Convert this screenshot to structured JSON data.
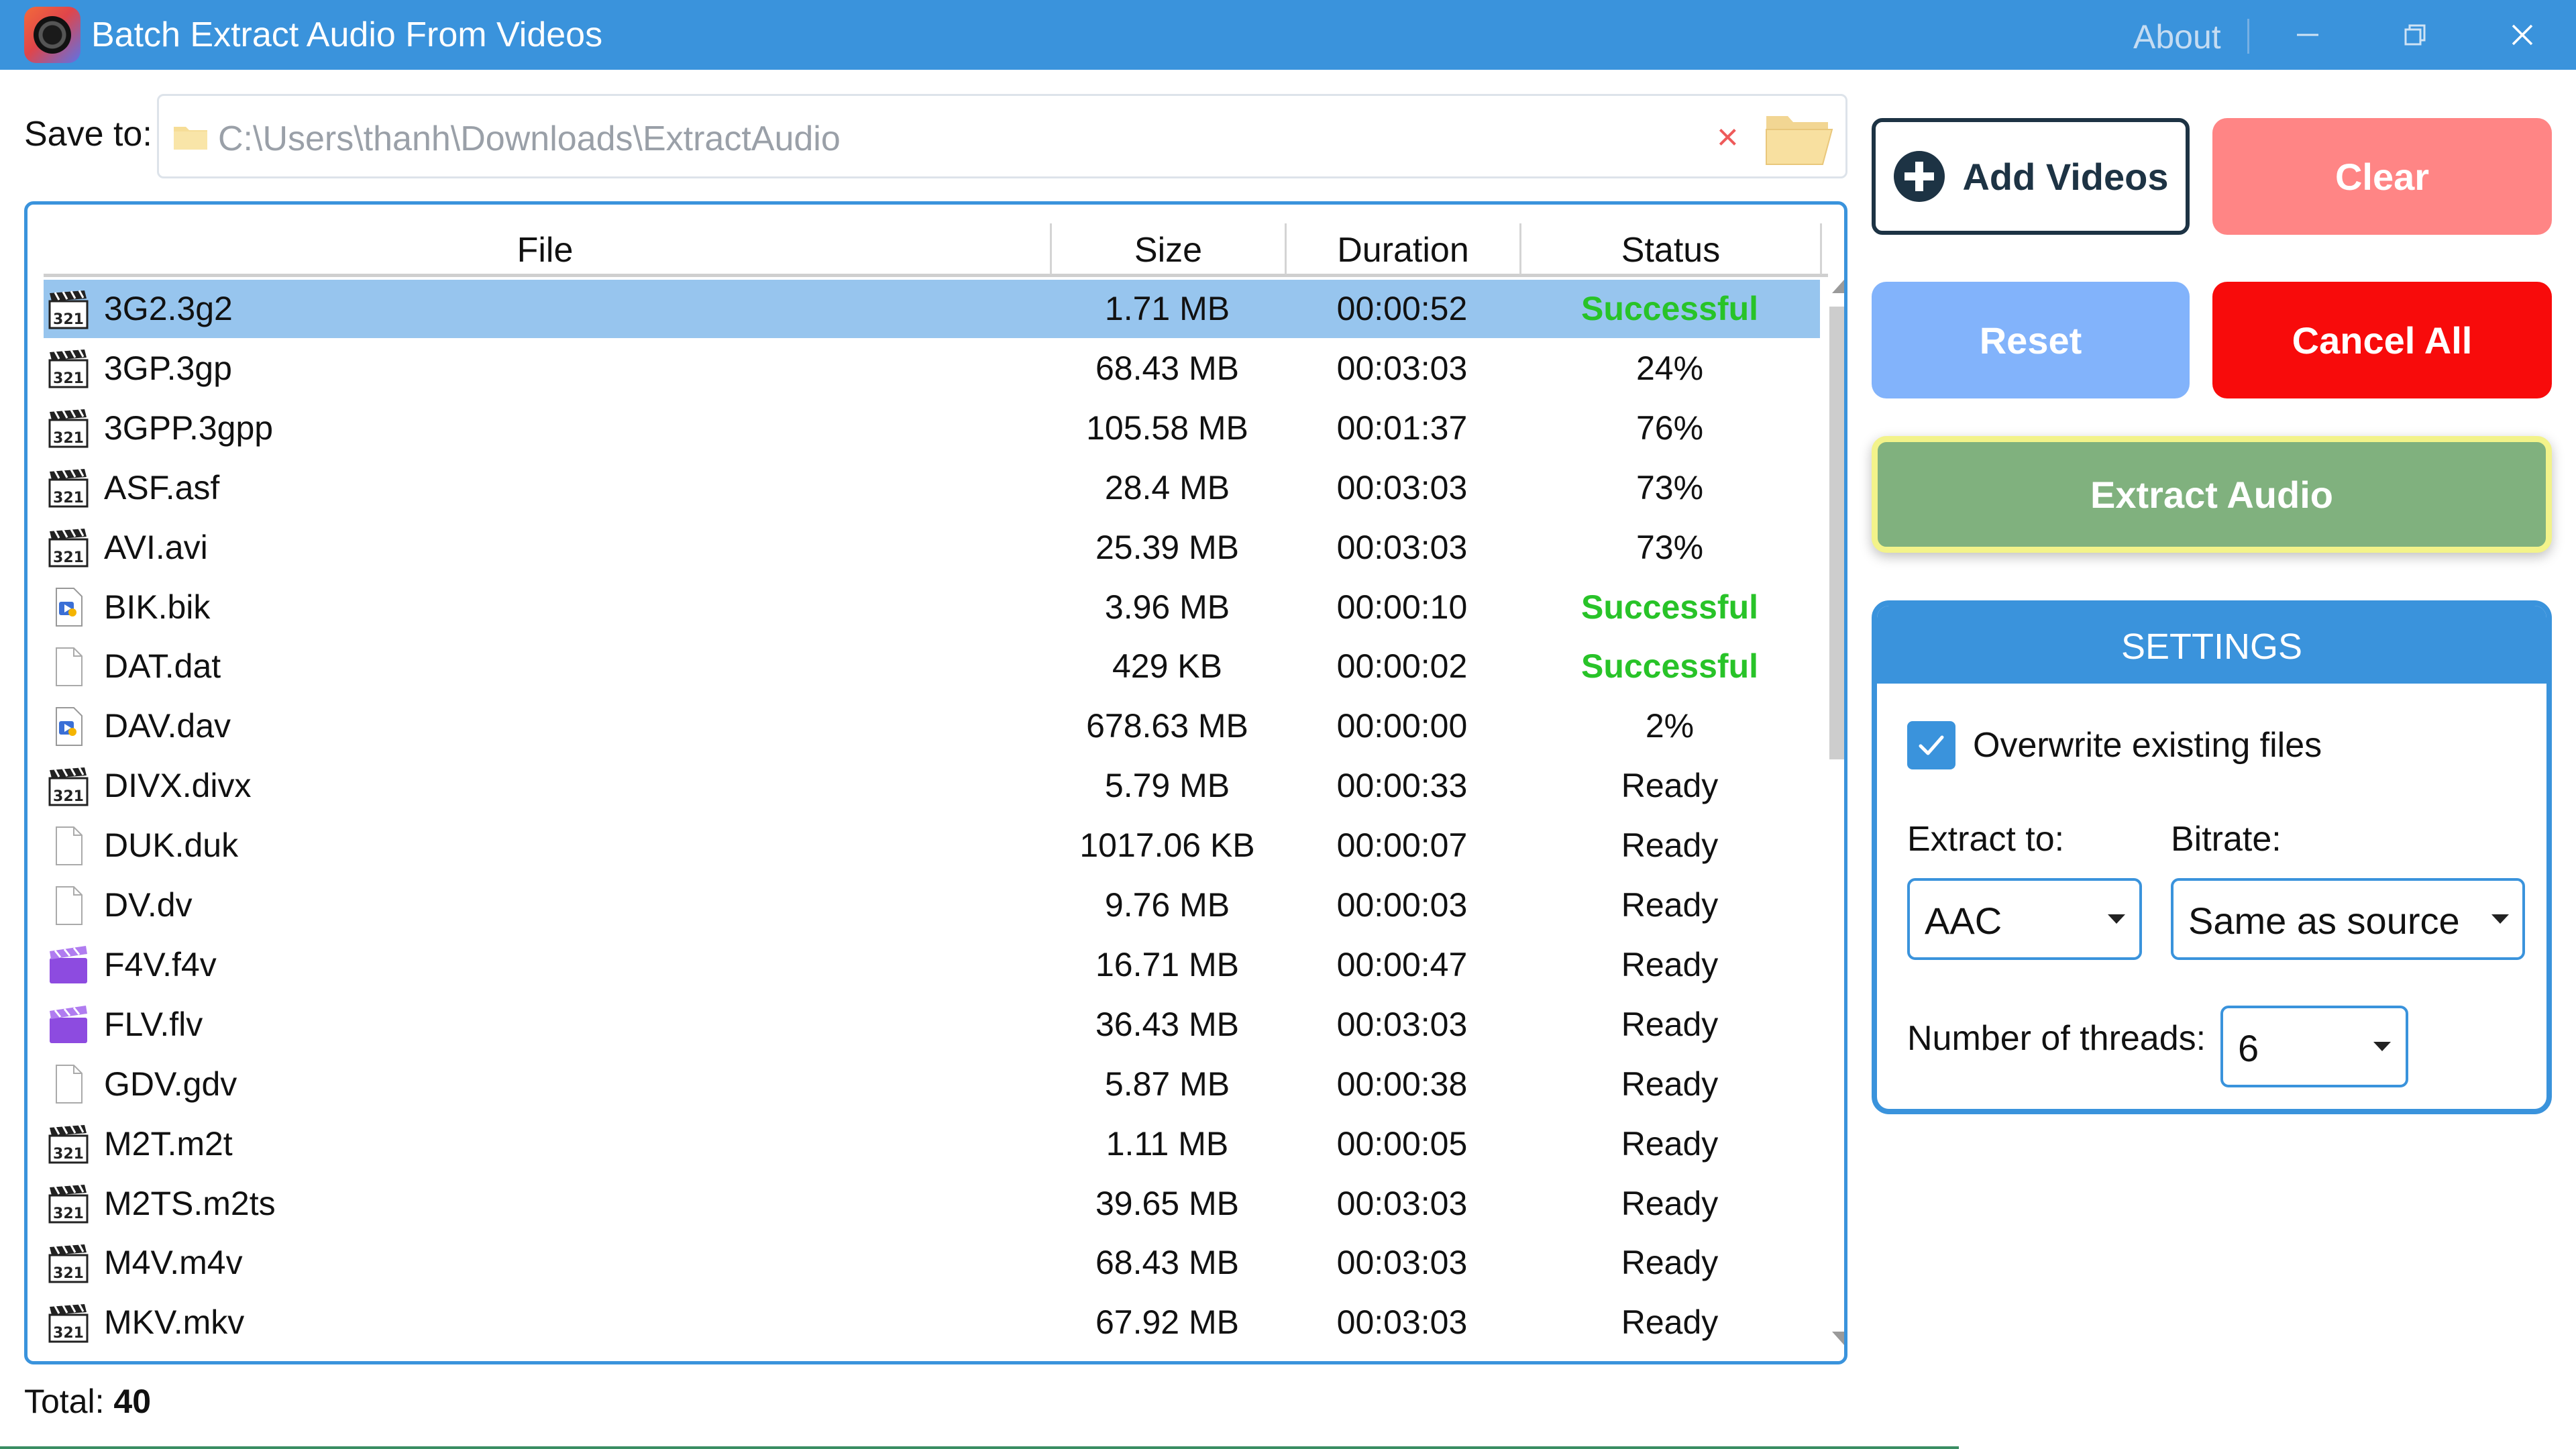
{
  "window": {
    "title": "Batch Extract Audio From Videos",
    "about": "About"
  },
  "save": {
    "label": "Save to:",
    "path": "C:\\Users\\thanh\\Downloads\\ExtractAudio",
    "clear_icon": "close-icon"
  },
  "table": {
    "headers": {
      "file": "File",
      "size": "Size",
      "duration": "Duration",
      "status": "Status"
    },
    "rows": [
      {
        "name": "3G2.3g2",
        "icon": "clapper",
        "size": "1.71 MB",
        "duration": "00:00:52",
        "status": "Successful",
        "ok": true,
        "selected": true
      },
      {
        "name": "3GP.3gp",
        "icon": "clapper",
        "size": "68.43 MB",
        "duration": "00:03:03",
        "status": "24%"
      },
      {
        "name": "3GPP.3gpp",
        "icon": "clapper",
        "size": "105.58 MB",
        "duration": "00:01:37",
        "status": "76%"
      },
      {
        "name": "ASF.asf",
        "icon": "clapper",
        "size": "28.4 MB",
        "duration": "00:03:03",
        "status": "73%"
      },
      {
        "name": "AVI.avi",
        "icon": "clapper",
        "size": "25.39 MB",
        "duration": "00:03:03",
        "status": "73%"
      },
      {
        "name": "BIK.bik",
        "icon": "media",
        "size": "3.96 MB",
        "duration": "00:00:10",
        "status": "Successful",
        "ok": true
      },
      {
        "name": "DAT.dat",
        "icon": "blank",
        "size": "429 KB",
        "duration": "00:00:02",
        "status": "Successful",
        "ok": true
      },
      {
        "name": "DAV.dav",
        "icon": "media",
        "size": "678.63 MB",
        "duration": "00:00:00",
        "status": "2%"
      },
      {
        "name": "DIVX.divx",
        "icon": "clapper",
        "size": "5.79 MB",
        "duration": "00:00:33",
        "status": "Ready"
      },
      {
        "name": "DUK.duk",
        "icon": "blank",
        "size": "1017.06 KB",
        "duration": "00:00:07",
        "status": "Ready"
      },
      {
        "name": "DV.dv",
        "icon": "blank",
        "size": "9.76 MB",
        "duration": "00:00:03",
        "status": "Ready"
      },
      {
        "name": "F4V.f4v",
        "icon": "purple",
        "size": "16.71 MB",
        "duration": "00:00:47",
        "status": "Ready"
      },
      {
        "name": "FLV.flv",
        "icon": "purple",
        "size": "36.43 MB",
        "duration": "00:03:03",
        "status": "Ready"
      },
      {
        "name": "GDV.gdv",
        "icon": "blank",
        "size": "5.87 MB",
        "duration": "00:00:38",
        "status": "Ready"
      },
      {
        "name": "M2T.m2t",
        "icon": "clapper",
        "size": "1.11 MB",
        "duration": "00:00:05",
        "status": "Ready"
      },
      {
        "name": "M2TS.m2ts",
        "icon": "clapper",
        "size": "39.65 MB",
        "duration": "00:03:03",
        "status": "Ready"
      },
      {
        "name": "M4V.m4v",
        "icon": "clapper",
        "size": "68.43 MB",
        "duration": "00:03:03",
        "status": "Ready"
      },
      {
        "name": "MKV.mkv",
        "icon": "clapper",
        "size": "67.92 MB",
        "duration": "00:03:03",
        "status": "Ready"
      }
    ]
  },
  "total": {
    "label": "Total:",
    "count": "40"
  },
  "buttons": {
    "add_videos": "Add Videos",
    "clear": "Clear",
    "reset": "Reset",
    "cancel_all": "Cancel All",
    "extract_audio": "Extract Audio"
  },
  "settings": {
    "title": "SETTINGS",
    "overwrite_label": "Overwrite existing files",
    "overwrite_checked": true,
    "extract_to_label": "Extract to:",
    "extract_to_value": "AAC",
    "bitrate_label": "Bitrate:",
    "bitrate_value": "Same as source",
    "threads_label": "Number of threads:",
    "threads_value": "6"
  },
  "colors": {
    "accent": "#3a93dc",
    "success": "#28c328",
    "clear": "#ff8585",
    "reset": "#82b3fb",
    "cancel": "#f80b0b",
    "extract": "#80b17e",
    "selected_row": "#97c5ee"
  }
}
